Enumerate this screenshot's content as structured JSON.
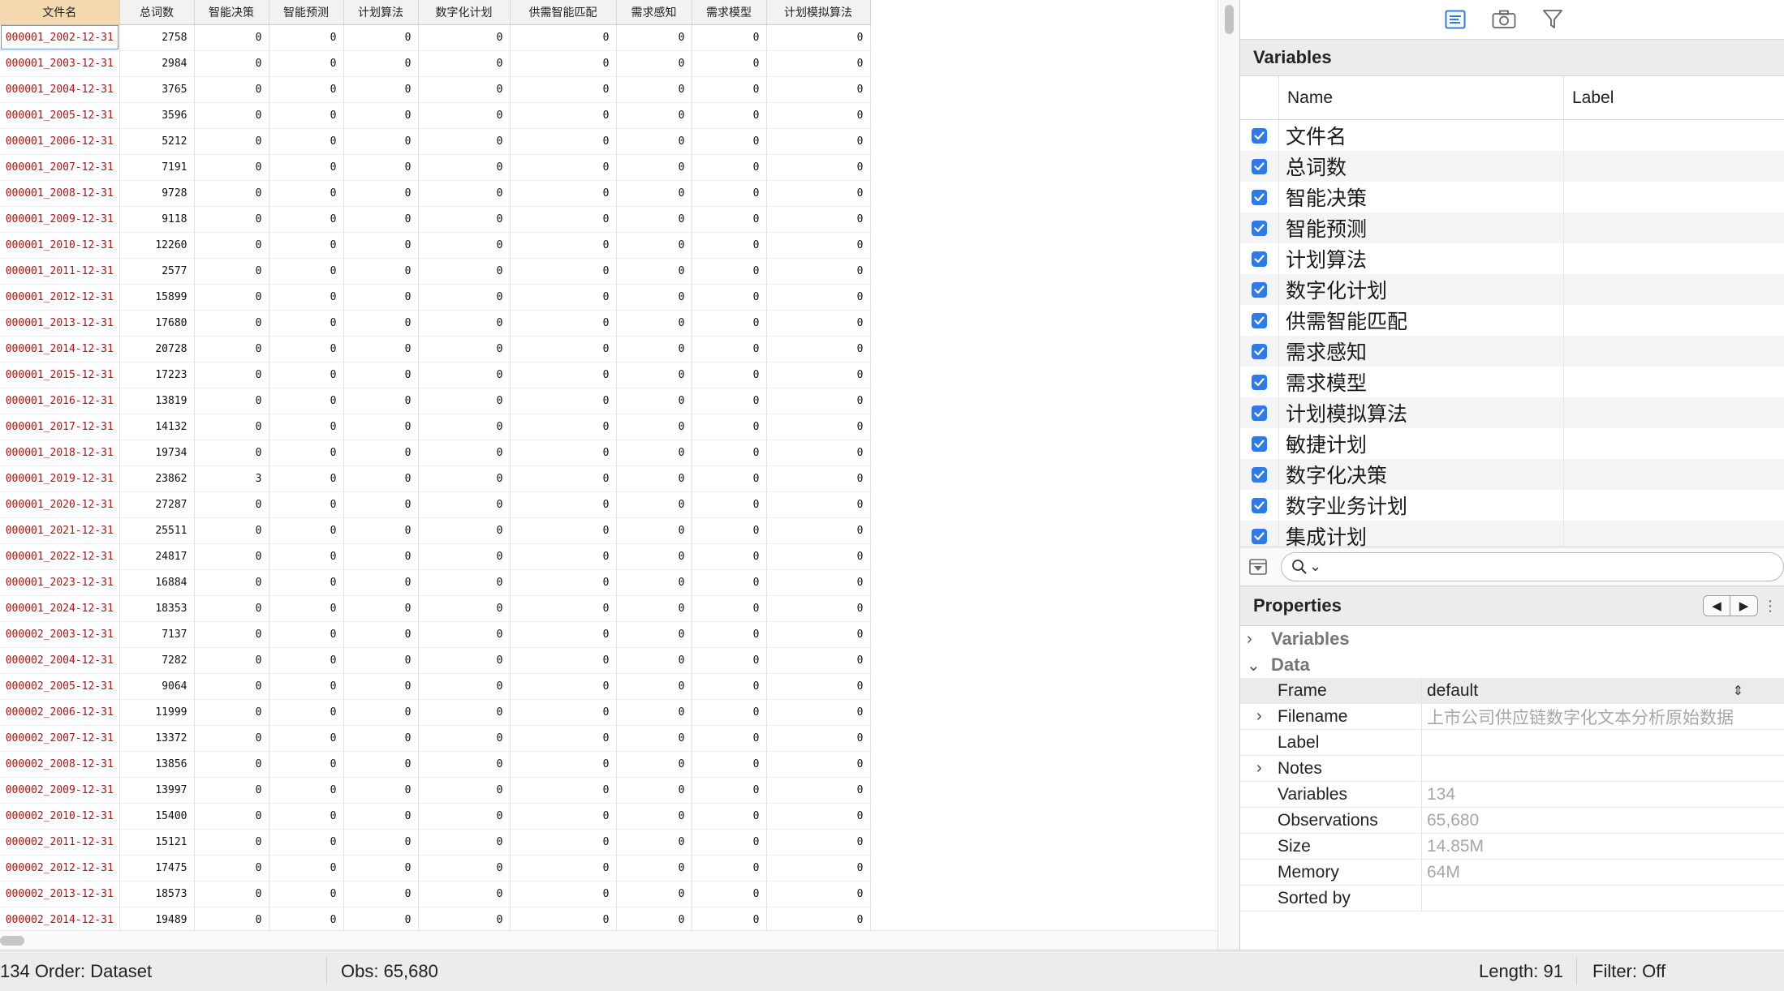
{
  "grid": {
    "columns": [
      "文件名",
      "总词数",
      "智能决策",
      "智能预测",
      "计划算法",
      "数字化计划",
      "供需智能匹配",
      "需求感知",
      "需求模型",
      "计划模拟算法"
    ],
    "rows": [
      [
        "000001_2002-12-31",
        "2758",
        "0",
        "0",
        "0",
        "0",
        "0",
        "0",
        "0",
        "0"
      ],
      [
        "000001_2003-12-31",
        "2984",
        "0",
        "0",
        "0",
        "0",
        "0",
        "0",
        "0",
        "0"
      ],
      [
        "000001_2004-12-31",
        "3765",
        "0",
        "0",
        "0",
        "0",
        "0",
        "0",
        "0",
        "0"
      ],
      [
        "000001_2005-12-31",
        "3596",
        "0",
        "0",
        "0",
        "0",
        "0",
        "0",
        "0",
        "0"
      ],
      [
        "000001_2006-12-31",
        "5212",
        "0",
        "0",
        "0",
        "0",
        "0",
        "0",
        "0",
        "0"
      ],
      [
        "000001_2007-12-31",
        "7191",
        "0",
        "0",
        "0",
        "0",
        "0",
        "0",
        "0",
        "0"
      ],
      [
        "000001_2008-12-31",
        "9728",
        "0",
        "0",
        "0",
        "0",
        "0",
        "0",
        "0",
        "0"
      ],
      [
        "000001_2009-12-31",
        "9118",
        "0",
        "0",
        "0",
        "0",
        "0",
        "0",
        "0",
        "0"
      ],
      [
        "000001_2010-12-31",
        "12260",
        "0",
        "0",
        "0",
        "0",
        "0",
        "0",
        "0",
        "0"
      ],
      [
        "000001_2011-12-31",
        "2577",
        "0",
        "0",
        "0",
        "0",
        "0",
        "0",
        "0",
        "0"
      ],
      [
        "000001_2012-12-31",
        "15899",
        "0",
        "0",
        "0",
        "0",
        "0",
        "0",
        "0",
        "0"
      ],
      [
        "000001_2013-12-31",
        "17680",
        "0",
        "0",
        "0",
        "0",
        "0",
        "0",
        "0",
        "0"
      ],
      [
        "000001_2014-12-31",
        "20728",
        "0",
        "0",
        "0",
        "0",
        "0",
        "0",
        "0",
        "0"
      ],
      [
        "000001_2015-12-31",
        "17223",
        "0",
        "0",
        "0",
        "0",
        "0",
        "0",
        "0",
        "0"
      ],
      [
        "000001_2016-12-31",
        "13819",
        "0",
        "0",
        "0",
        "0",
        "0",
        "0",
        "0",
        "0"
      ],
      [
        "000001_2017-12-31",
        "14132",
        "0",
        "0",
        "0",
        "0",
        "0",
        "0",
        "0",
        "0"
      ],
      [
        "000001_2018-12-31",
        "19734",
        "0",
        "0",
        "0",
        "0",
        "0",
        "0",
        "0",
        "0"
      ],
      [
        "000001_2019-12-31",
        "23862",
        "3",
        "0",
        "0",
        "0",
        "0",
        "0",
        "0",
        "0"
      ],
      [
        "000001_2020-12-31",
        "27287",
        "0",
        "0",
        "0",
        "0",
        "0",
        "0",
        "0",
        "0"
      ],
      [
        "000001_2021-12-31",
        "25511",
        "0",
        "0",
        "0",
        "0",
        "0",
        "0",
        "0",
        "0"
      ],
      [
        "000001_2022-12-31",
        "24817",
        "0",
        "0",
        "0",
        "0",
        "0",
        "0",
        "0",
        "0"
      ],
      [
        "000001_2023-12-31",
        "16884",
        "0",
        "0",
        "0",
        "0",
        "0",
        "0",
        "0",
        "0"
      ],
      [
        "000001_2024-12-31",
        "18353",
        "0",
        "0",
        "0",
        "0",
        "0",
        "0",
        "0",
        "0"
      ],
      [
        "000002_2003-12-31",
        "7137",
        "0",
        "0",
        "0",
        "0",
        "0",
        "0",
        "0",
        "0"
      ],
      [
        "000002_2004-12-31",
        "7282",
        "0",
        "0",
        "0",
        "0",
        "0",
        "0",
        "0",
        "0"
      ],
      [
        "000002_2005-12-31",
        "9064",
        "0",
        "0",
        "0",
        "0",
        "0",
        "0",
        "0",
        "0"
      ],
      [
        "000002_2006-12-31",
        "11999",
        "0",
        "0",
        "0",
        "0",
        "0",
        "0",
        "0",
        "0"
      ],
      [
        "000002_2007-12-31",
        "13372",
        "0",
        "0",
        "0",
        "0",
        "0",
        "0",
        "0",
        "0"
      ],
      [
        "000002_2008-12-31",
        "13856",
        "0",
        "0",
        "0",
        "0",
        "0",
        "0",
        "0",
        "0"
      ],
      [
        "000002_2009-12-31",
        "13997",
        "0",
        "0",
        "0",
        "0",
        "0",
        "0",
        "0",
        "0"
      ],
      [
        "000002_2010-12-31",
        "15400",
        "0",
        "0",
        "0",
        "0",
        "0",
        "0",
        "0",
        "0"
      ],
      [
        "000002_2011-12-31",
        "15121",
        "0",
        "0",
        "0",
        "0",
        "0",
        "0",
        "0",
        "0"
      ],
      [
        "000002_2012-12-31",
        "17475",
        "0",
        "0",
        "0",
        "0",
        "0",
        "0",
        "0",
        "0"
      ],
      [
        "000002_2013-12-31",
        "18573",
        "0",
        "0",
        "0",
        "0",
        "0",
        "0",
        "0",
        "0"
      ],
      [
        "000002_2014-12-31",
        "19489",
        "0",
        "0",
        "0",
        "0",
        "0",
        "0",
        "0",
        "0"
      ]
    ]
  },
  "toolbar": {
    "icons": [
      "variables-panel-icon",
      "snapshot-camera-icon",
      "filter-funnel-icon"
    ]
  },
  "variables": {
    "title": "Variables",
    "name_header": "Name",
    "label_header": "Label",
    "items": [
      "文件名",
      "总词数",
      "智能决策",
      "智能预测",
      "计划算法",
      "数字化计划",
      "供需智能匹配",
      "需求感知",
      "需求模型",
      "计划模拟算法",
      "敏捷计划",
      "数字化决策",
      "数字业务计划",
      "集成计划"
    ]
  },
  "search": {
    "icon": "search-icon",
    "chevron": "⌄"
  },
  "properties": {
    "title": "Properties",
    "prev": "◀",
    "next": "▶",
    "more": "⋮",
    "groups": {
      "variables": "Variables",
      "data": "Data"
    },
    "rows": [
      {
        "key": "Frame",
        "value": "default"
      },
      {
        "key": "Filename",
        "value": "上市公司供应链数字化文本分析原始数据"
      },
      {
        "key": "Label",
        "value": ""
      },
      {
        "key": "Notes",
        "value": ""
      },
      {
        "key": "Variables",
        "value": "134"
      },
      {
        "key": "Observations",
        "value": "65,680"
      },
      {
        "key": "Size",
        "value": "14.85M"
      },
      {
        "key": "Memory",
        "value": "64M"
      },
      {
        "key": "Sorted by",
        "value": ""
      }
    ]
  },
  "status": {
    "vars_order": "134  Order: Dataset",
    "obs": "Obs: 65,680",
    "length": "Length: 91",
    "filter": "Filter: Off"
  },
  "colors": {
    "accent": "#2f7be6",
    "selected_header": "#f4d9b0",
    "filename_text": "#b01515"
  }
}
